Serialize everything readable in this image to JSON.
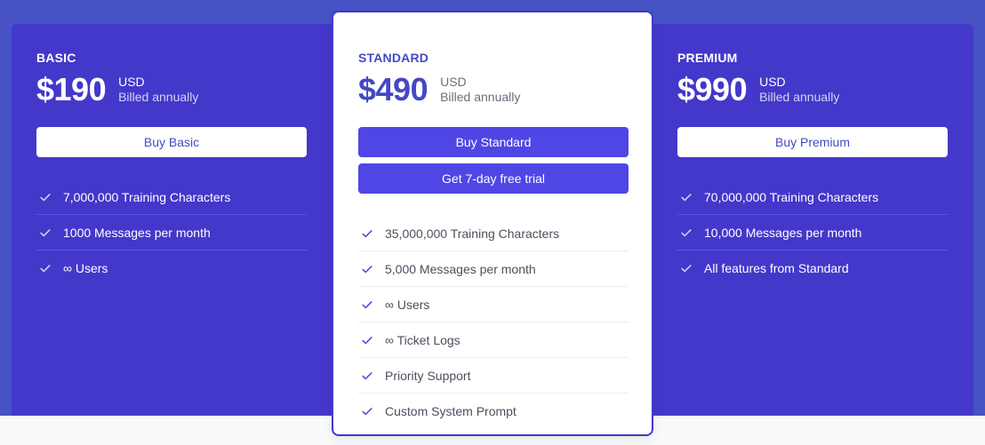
{
  "plans": {
    "basic": {
      "tier": "BASIC",
      "price": "$190",
      "currency": "USD",
      "billing": "Billed annually",
      "buy_label": "Buy Basic",
      "features": [
        "7,000,000 Training Characters",
        "1000 Messages per month",
        "∞ Users"
      ]
    },
    "standard": {
      "tier": "STANDARD",
      "price": "$490",
      "currency": "USD",
      "billing": "Billed annually",
      "buy_label": "Buy Standard",
      "trial_label": "Get 7-day free trial",
      "features": [
        "35,000,000 Training Characters",
        "5,000 Messages per month",
        "∞ Users",
        "∞ Ticket Logs",
        "Priority Support",
        "Custom System Prompt"
      ]
    },
    "premium": {
      "tier": "PREMIUM",
      "price": "$990",
      "currency": "USD",
      "billing": "Billed annually",
      "buy_label": "Buy Premium",
      "features": [
        "70,000,000 Training Characters",
        "10,000 Messages per month",
        "All features from Standard"
      ]
    }
  },
  "icons": {
    "feature_bullet": "check-icon"
  },
  "colors": {
    "brand": "#4338ca",
    "accent": "#4f46e5",
    "header_band": "#4752c4",
    "highlight_text": "#4448c4"
  }
}
